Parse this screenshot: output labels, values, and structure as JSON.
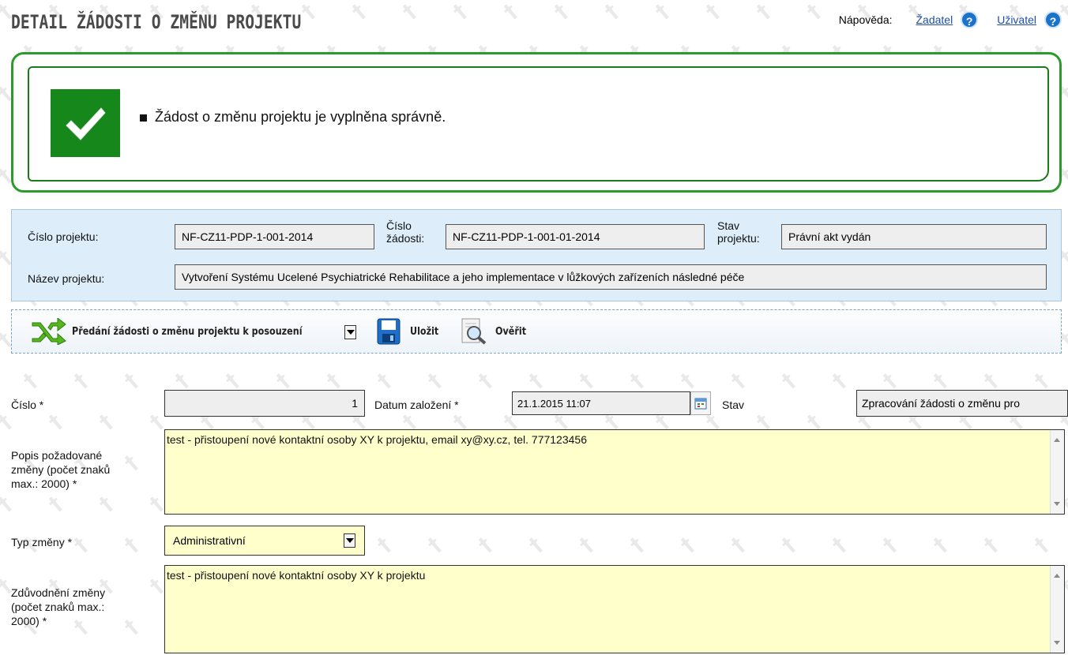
{
  "header": {
    "title": "DETAIL ŽÁDOSTI O ZMĚNU PROJEKTU",
    "help_label": "Nápověda:",
    "help_applicant": "Žadatel",
    "help_user": "Uživatel",
    "help_icon": "question-icon"
  },
  "success": {
    "icon": "checkmark-icon",
    "message": "Žádost o změnu projektu je vyplněna správně."
  },
  "project_info": {
    "project_number_label": "Číslo projektu:",
    "project_number": "NF-CZ11-PDP-1-001-2014",
    "request_number_label_1": "Číslo",
    "request_number_label_2": "žádosti:",
    "request_number": "NF-CZ11-PDP-1-001-01-2014",
    "project_state_label_1": "Stav",
    "project_state_label_2": "projektu:",
    "project_state": "Právní akt vydán",
    "project_name_label": "Název projektu:",
    "project_name": "Vytvoření Systému Ucelené Psychiatrické Rehabilitace a jeho implementace v lůžkových zařízeních následné péče"
  },
  "toolbar": {
    "submit_label": "Předání žádosti o změnu projektu k posouzení",
    "save_label": "Uložit",
    "verify_label": "Ověřit"
  },
  "form": {
    "number_label": "Číslo *",
    "number_value": "1",
    "created_label": "Datum založení *",
    "created_value": "21.1.2015 11:07",
    "state_label": "Stav",
    "state_value": "Zpracování žádosti o změnu pro",
    "description_label_1": "Popis požadované",
    "description_label_2": "změny (počet znaků",
    "description_label_3": "max.: 2000) *",
    "description_value": "test - přistoupení nové kontaktní osoby XY k projektu, email xy@xy.cz, tel. 777123456",
    "change_type_label": "Typ změny *",
    "change_type_value": "Administrativní",
    "justification_label_1": "Zdůvodnění změny",
    "justification_label_2": "(počet znaků max.:",
    "justification_label_3": "2000) *",
    "justification_value": "test - přistoupení nové kontaktní osoby XY k projektu"
  },
  "colors": {
    "success_green": "#15871b",
    "panel_blue": "#ddeefa",
    "input_yellow": "#ffffcc",
    "link_blue": "#1f4fa0"
  }
}
